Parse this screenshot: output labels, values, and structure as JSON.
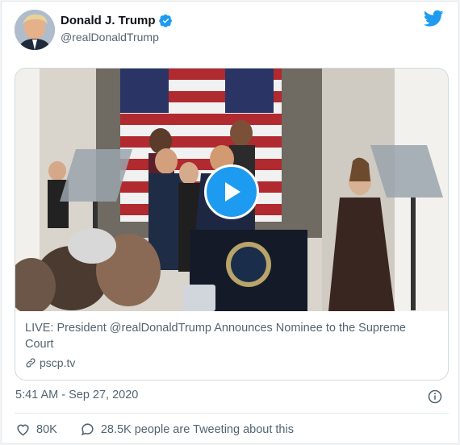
{
  "author": {
    "display_name": "Donald J. Trump",
    "handle": "@realDonaldTrump",
    "verified": true
  },
  "icons": {
    "verified": "verified-badge-icon",
    "brand": "twitter-bird-icon",
    "play": "play-icon",
    "link": "link-icon",
    "info": "info-icon",
    "like": "heart-icon",
    "reply": "speech-bubble-icon"
  },
  "card": {
    "title": "LIVE: President @realDonaldTrump Announces Nominee to the Supreme Court",
    "domain": "pscp.tv"
  },
  "timestamp": "5:41 AM - Sep 27, 2020",
  "stats": {
    "likes": "80K",
    "talking": "28.5K people are Tweeting about this"
  },
  "colors": {
    "brand_blue": "#1d9bf0",
    "text_secondary": "#536471",
    "border": "#cfd9de"
  }
}
